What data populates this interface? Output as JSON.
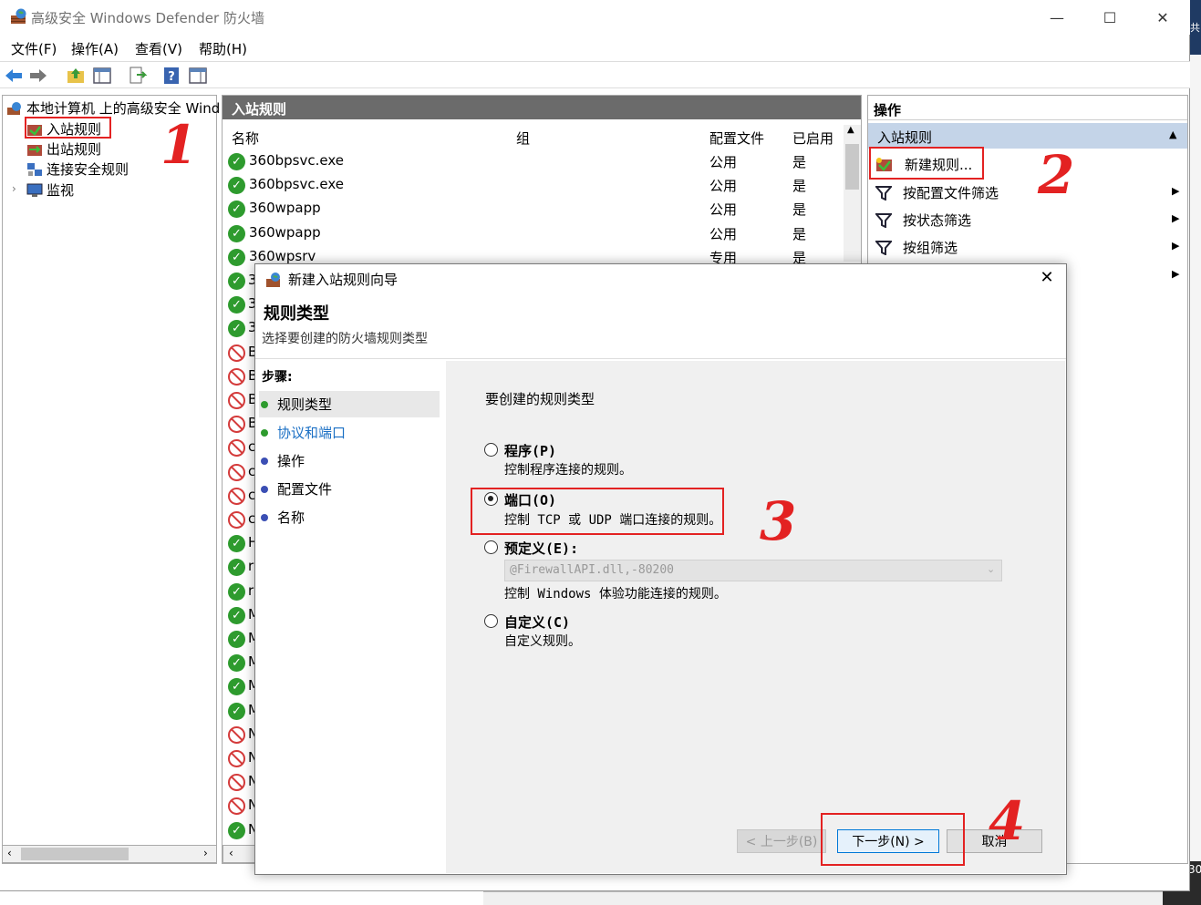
{
  "window": {
    "title": "高级安全 Windows Defender 防火墙",
    "minimize": "—",
    "maximize": "☐",
    "close": "✕"
  },
  "menu": [
    "文件(F)",
    "操作(A)",
    "查看(V)",
    "帮助(H)"
  ],
  "tree": {
    "root": "本地计算机 上的高级安全 Wind",
    "items": [
      "入站规则",
      "出站规则",
      "连接安全规则",
      "监视"
    ],
    "expander": "›"
  },
  "list": {
    "header": "入站规则",
    "columns": [
      "名称",
      "组",
      "配置文件",
      "已启用"
    ],
    "rows": [
      {
        "name": "360bpsvc.exe",
        "profile": "公用",
        "enabled": "是",
        "status": "allow"
      },
      {
        "name": "360bpsvc.exe",
        "profile": "公用",
        "enabled": "是",
        "status": "allow"
      },
      {
        "name": "360wpapp",
        "profile": "公用",
        "enabled": "是",
        "status": "allow"
      },
      {
        "name": "360wpapp",
        "profile": "公用",
        "enabled": "是",
        "status": "allow"
      },
      {
        "name": "360wpsrv",
        "profile": "专用",
        "enabled": "是",
        "status": "allow"
      }
    ],
    "hidden_rows": [
      {
        "name": "3",
        "status": "allow"
      },
      {
        "name": "3",
        "status": "allow"
      },
      {
        "name": "3",
        "status": "allow"
      },
      {
        "name": "B",
        "status": "block"
      },
      {
        "name": "B",
        "status": "block"
      },
      {
        "name": "B",
        "status": "block"
      },
      {
        "name": "B",
        "status": "block"
      },
      {
        "name": "c",
        "status": "block"
      },
      {
        "name": "c",
        "status": "block"
      },
      {
        "name": "c",
        "status": "block"
      },
      {
        "name": "c",
        "status": "block"
      },
      {
        "name": "H",
        "status": "allow"
      },
      {
        "name": "r",
        "status": "allow"
      },
      {
        "name": "r",
        "status": "allow"
      },
      {
        "name": "M",
        "status": "allow"
      },
      {
        "name": "M",
        "status": "allow"
      },
      {
        "name": "M",
        "status": "allow"
      },
      {
        "name": "M",
        "status": "allow"
      },
      {
        "name": "M",
        "status": "allow"
      },
      {
        "name": "N",
        "status": "block"
      },
      {
        "name": "N",
        "status": "block"
      },
      {
        "name": "N",
        "status": "block"
      },
      {
        "name": "N",
        "status": "block"
      },
      {
        "name": "N",
        "status": "allow"
      }
    ]
  },
  "actions": {
    "header": "操作",
    "section": "入站规则",
    "items": [
      "新建规则...",
      "按配置文件筛选",
      "按状态筛选",
      "按组筛选"
    ]
  },
  "dialog": {
    "title": "新建入站规则向导",
    "close": "✕",
    "heading": "规则类型",
    "subheading": "选择要创建的防火墙规则类型",
    "steps_label": "步骤:",
    "steps": [
      {
        "label": "规则类型",
        "state": "current"
      },
      {
        "label": "协议和端口",
        "state": "link"
      },
      {
        "label": "操作",
        "state": "pending"
      },
      {
        "label": "配置文件",
        "state": "pending"
      },
      {
        "label": "名称",
        "state": "pending"
      }
    ],
    "question": "要创建的规则类型",
    "options": [
      {
        "title": "程序(P)",
        "desc": "控制程序连接的规则。",
        "selected": false
      },
      {
        "title": "端口(O)",
        "desc": "控制 TCP 或 UDP 端口连接的规则。",
        "selected": true
      },
      {
        "title": "预定义(E):",
        "desc": "控制 Windows 体验功能连接的规则。",
        "selected": false
      },
      {
        "title": "自定义(C)",
        "desc": "自定义规则。",
        "selected": false
      }
    ],
    "predefined_value": "@FirewallAPI.dll,-80200",
    "buttons": {
      "back": "< 上一步(B)",
      "next": "下一步(N) >",
      "cancel": "取消"
    }
  },
  "annotations": [
    "1",
    "2",
    "3",
    "4"
  ],
  "desktop": {
    "top_text": "共",
    "bottom_text": "30"
  },
  "colors": {
    "annotation": "#e32222",
    "allow": "#2e9b2e",
    "block": "#d43b3b",
    "link": "#1a6fc4",
    "section": "#c4d4e8"
  }
}
